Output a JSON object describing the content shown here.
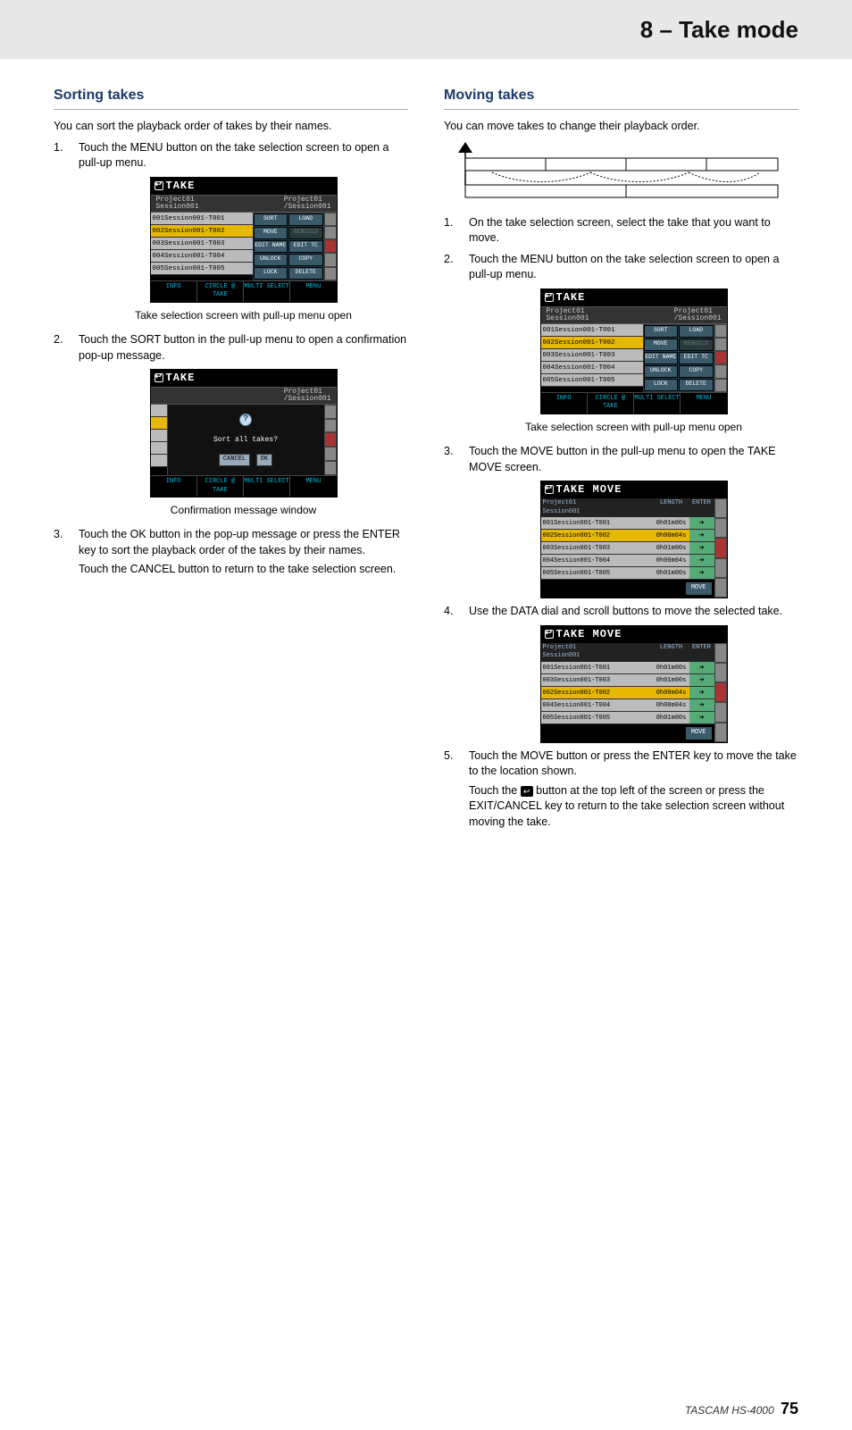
{
  "header": {
    "title": "8 – Take mode"
  },
  "left": {
    "title": "Sorting takes",
    "intro": "You can sort the playback order of takes by their names.",
    "step1": "Touch the MENU button on the take selection screen to open a pull-up menu.",
    "caption1": "Take selection screen with pull-up menu open",
    "step2": "Touch the SORT button in the pull-up menu to open a confirmation pop-up message.",
    "caption2": "Confirmation message window",
    "step3a": "Touch the OK button in the pop-up message or press the ENTER key to sort the playback order of the takes by their names.",
    "step3b": "Touch the CANCEL button to return to the take selection screen."
  },
  "right": {
    "title": "Moving takes",
    "intro": "You can move takes to change their playback order.",
    "step1": "On the take selection screen, select the take that you want to move.",
    "step2": "Touch the MENU button on the take selection screen to open a pull-up menu.",
    "caption1": "Take selection screen with pull-up menu open",
    "step3": "Touch the MOVE button in the pull-up menu to open the TAKE MOVE screen.",
    "step4": "Use the DATA dial and scroll buttons to move the selected take.",
    "step5a": "Touch the MOVE button or press the ENTER key to move the take to the location shown.",
    "step5b_pre": "Touch the ",
    "step5b_post": " button at the top left of the screen or press the EXIT/CANCEL key to return to the take selection screen without moving the take."
  },
  "ui": {
    "take_title": "TAKE",
    "takemove_title": "TAKE MOVE",
    "crumb": "Project01\n/Session001",
    "crumb_path": "Project01\nSession001",
    "rows": [
      "001Session001-T001",
      "002Session001-T002",
      "003Session001-T003",
      "004Session001-T004",
      "005Session001-T005"
    ],
    "menu_buttons": [
      "SORT",
      "LOAD",
      "MOVE",
      "REBUILD",
      "EDIT NAME",
      "EDIT TC",
      "UNLOCK",
      "COPY",
      "LOCK",
      "DELETE"
    ],
    "foot": [
      "INFO",
      "CIRCLE @ TAKE",
      "MULTI SELECT",
      "MENU"
    ],
    "confirm_msg": "Sort all takes?",
    "confirm_cancel": "CANCEL",
    "confirm_ok": "OK",
    "move_head": [
      "",
      "LENGTH",
      "ENTER"
    ],
    "move_btn": "MOVE",
    "move_rows_1": [
      {
        "name": "001Session001-T001",
        "len": "0h01m00s",
        "sel": false
      },
      {
        "name": "002Session001-T002",
        "len": "0h00m04s",
        "sel": true
      },
      {
        "name": "003Session001-T003",
        "len": "0h01m00s",
        "sel": false
      },
      {
        "name": "004Session001-T004",
        "len": "0h00m04s",
        "sel": false
      },
      {
        "name": "005Session001-T005",
        "len": "0h01m00s",
        "sel": false
      }
    ],
    "move_rows_2": [
      {
        "name": "001Session001-T001",
        "len": "0h01m00s",
        "sel": false
      },
      {
        "name": "003Session001-T003",
        "len": "0h01m00s",
        "sel": false
      },
      {
        "name": "002Session001-T002",
        "len": "0h00m04s",
        "sel": true
      },
      {
        "name": "004Session001-T004",
        "len": "0h00m04s",
        "sel": false
      },
      {
        "name": "005Session001-T005",
        "len": "0h01m00s",
        "sel": false
      }
    ]
  },
  "footer": {
    "brand": "TASCAM HS-4000",
    "page": "75"
  }
}
